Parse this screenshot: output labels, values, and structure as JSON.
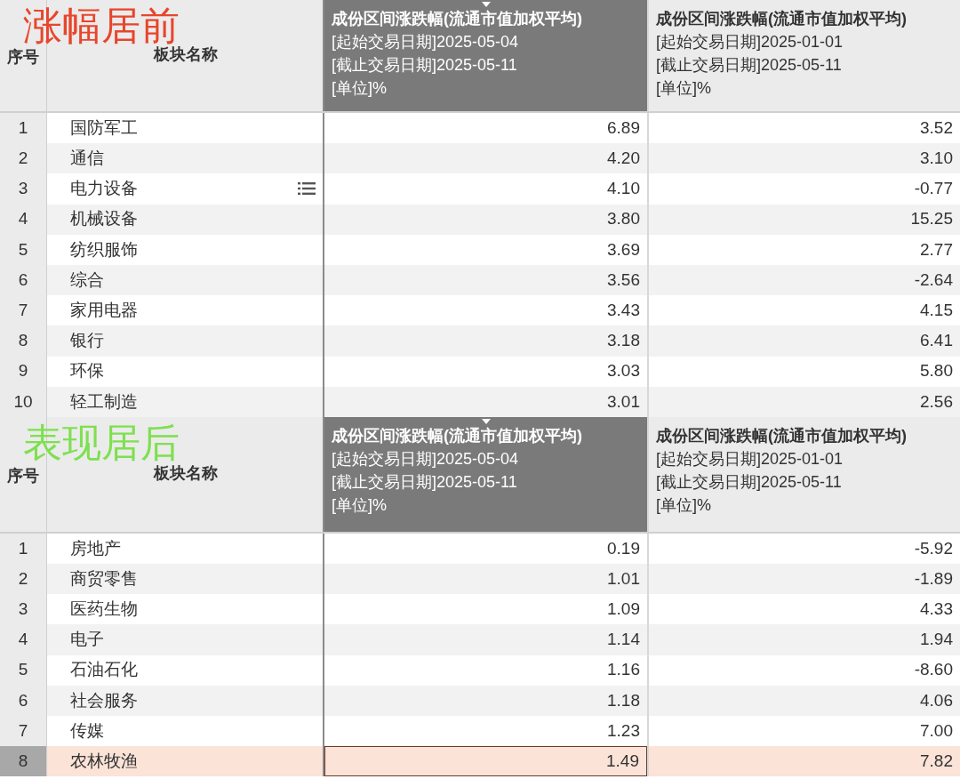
{
  "tables": [
    {
      "label": "涨幅居前",
      "color": "#e8452c",
      "index_header": "序号",
      "name_header": "板块名称",
      "columns": [
        {
          "title": "成份区间涨跌幅(流通市值加权平均)",
          "lines": [
            "[起始交易日期]2025-05-04",
            "[截止交易日期]2025-05-11",
            "[单位]%"
          ],
          "selected": true
        },
        {
          "title": "成份区间涨跌幅(流通市值加权平均)",
          "lines": [
            "[起始交易日期]2025-01-01",
            "[截止交易日期]2025-05-11",
            "[单位]%"
          ],
          "selected": false
        }
      ],
      "rows": [
        {
          "index": "1",
          "name": "国防军工",
          "values": [
            "6.89",
            "3.52"
          ],
          "selected": false,
          "hovered": false
        },
        {
          "index": "2",
          "name": "通信",
          "values": [
            "4.20",
            "3.10"
          ],
          "selected": false,
          "hovered": false
        },
        {
          "index": "3",
          "name": "电力设备",
          "values": [
            "4.10",
            "-0.77"
          ],
          "selected": false,
          "hovered": true
        },
        {
          "index": "4",
          "name": "机械设备",
          "values": [
            "3.80",
            "15.25"
          ],
          "selected": false,
          "hovered": false
        },
        {
          "index": "5",
          "name": "纺织服饰",
          "values": [
            "3.69",
            "2.77"
          ],
          "selected": false,
          "hovered": false
        },
        {
          "index": "6",
          "name": "综合",
          "values": [
            "3.56",
            "-2.64"
          ],
          "selected": false,
          "hovered": false
        },
        {
          "index": "7",
          "name": "家用电器",
          "values": [
            "3.43",
            "4.15"
          ],
          "selected": false,
          "hovered": false
        },
        {
          "index": "8",
          "name": "银行",
          "values": [
            "3.18",
            "6.41"
          ],
          "selected": false,
          "hovered": false
        },
        {
          "index": "9",
          "name": "环保",
          "values": [
            "3.03",
            "5.80"
          ],
          "selected": false,
          "hovered": false
        },
        {
          "index": "10",
          "name": "轻工制造",
          "values": [
            "3.01",
            "2.56"
          ],
          "selected": false,
          "hovered": false
        }
      ]
    },
    {
      "label": "表现居后",
      "color": "#7ee04f",
      "index_header": "序号",
      "name_header": "板块名称",
      "columns": [
        {
          "title": "成份区间涨跌幅(流通市值加权平均)",
          "lines": [
            "[起始交易日期]2025-05-04",
            "[截止交易日期]2025-05-11",
            "[单位]%"
          ],
          "selected": true
        },
        {
          "title": "成份区间涨跌幅(流通市值加权平均)",
          "lines": [
            "[起始交易日期]2025-01-01",
            "[截止交易日期]2025-05-11",
            "[单位]%"
          ],
          "selected": false
        }
      ],
      "rows": [
        {
          "index": "1",
          "name": "房地产",
          "values": [
            "0.19",
            "-5.92"
          ],
          "selected": false,
          "hovered": false
        },
        {
          "index": "2",
          "name": "商贸零售",
          "values": [
            "1.01",
            "-1.89"
          ],
          "selected": false,
          "hovered": false
        },
        {
          "index": "3",
          "name": "医药生物",
          "values": [
            "1.09",
            "4.33"
          ],
          "selected": false,
          "hovered": false
        },
        {
          "index": "4",
          "name": "电子",
          "values": [
            "1.14",
            "1.94"
          ],
          "selected": false,
          "hovered": false
        },
        {
          "index": "5",
          "name": "石油石化",
          "values": [
            "1.16",
            "-8.60"
          ],
          "selected": false,
          "hovered": false
        },
        {
          "index": "6",
          "name": "社会服务",
          "values": [
            "1.18",
            "4.06"
          ],
          "selected": false,
          "hovered": false
        },
        {
          "index": "7",
          "name": "传媒",
          "values": [
            "1.23",
            "7.00"
          ],
          "selected": false,
          "hovered": false
        },
        {
          "index": "8",
          "name": "农林牧渔",
          "values": [
            "1.49",
            "7.82"
          ],
          "selected": true,
          "hovered": false
        }
      ]
    }
  ]
}
